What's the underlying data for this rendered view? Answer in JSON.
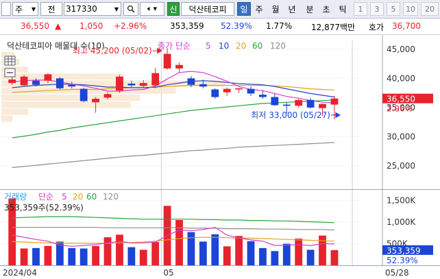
{
  "toolbar": {
    "type_label": "주",
    "prev_label": "전",
    "code": "317330",
    "new_label": "신",
    "stock_name": "덕산테코피",
    "periods": [
      "일",
      "주",
      "월",
      "년",
      "분",
      "초",
      "틱"
    ],
    "active_period": "일",
    "intervals": [
      "1",
      "3",
      "5",
      "10",
      "20"
    ]
  },
  "stock": {
    "price": "36,550",
    "change": "1,050",
    "change_pct": "+2.96%",
    "volume": "353,359",
    "vol_ratio": "52.39%",
    "turnover": "1.77%",
    "amount": "12,877백만",
    "bid_label": "호가",
    "bid_price": "36,700"
  },
  "colors": {
    "up": "#e8232d",
    "down": "#1b45d6",
    "ma5": "#d63bd1",
    "ma10": "#2142c4",
    "ma20": "#e5a11b",
    "ma60": "#29a33a",
    "ma120": "#8c8c8c"
  },
  "chart_data": {
    "type": "candlestick",
    "price_legend": {
      "title": "덕산테코피아 매물대 수(10)",
      "ma_label": "종가 단순",
      "periods": [
        "5",
        "10",
        "20",
        "60",
        "120"
      ]
    },
    "volume_legend": {
      "title": "거래량",
      "ma_label": "단순",
      "periods": [
        "5",
        "20",
        "60",
        "120"
      ]
    },
    "y_ticks": [
      "45,000",
      "40,000",
      "35,000",
      "30,000",
      "25,000"
    ],
    "y_tick_values": [
      45000,
      40000,
      35000,
      30000,
      25000
    ],
    "ylim": [
      21000,
      46500
    ],
    "vol_ticks": [
      "1,500K",
      "1,000K",
      "500K"
    ],
    "vol_tick_values": [
      1500000,
      1000000,
      500000
    ],
    "vol_ylim": [
      0,
      1750000
    ],
    "x_labels": [
      {
        "text": "2024/04",
        "index": 0
      },
      {
        "text": "05",
        "index": 13
      },
      {
        "text": "05/28",
        "index": 29
      }
    ],
    "high_annotation": "최고 45,200 (05/02)",
    "low_annotation": "최저 33,000 (05/27)",
    "high_index": 13,
    "high_value": 45200,
    "low_index": 28,
    "low_value": 33000,
    "volume_annotation": "353,359주(52.39%)",
    "current_price_tag": "36,550",
    "current_pct_tag": "2.96%",
    "current_volume_tag": "353,359",
    "current_vol_pct_tag": "52.39%",
    "current_price_value": 36550,
    "current_volume_value": 353359,
    "candles": [
      {
        "o": 39200,
        "h": 40400,
        "l": 38900,
        "c": 39800
      },
      {
        "o": 38800,
        "h": 40600,
        "l": 38600,
        "c": 40300
      },
      {
        "o": 39600,
        "h": 40000,
        "l": 38600,
        "c": 38900
      },
      {
        "o": 39600,
        "h": 40900,
        "l": 39200,
        "c": 40700
      },
      {
        "o": 40000,
        "h": 40200,
        "l": 38100,
        "c": 38300
      },
      {
        "o": 38900,
        "h": 39400,
        "l": 38300,
        "c": 38600
      },
      {
        "o": 38200,
        "h": 38400,
        "l": 35900,
        "c": 36100
      },
      {
        "o": 35900,
        "h": 36800,
        "l": 34100,
        "c": 36500
      },
      {
        "o": 36700,
        "h": 37600,
        "l": 36400,
        "c": 37300
      },
      {
        "o": 37900,
        "h": 40600,
        "l": 37500,
        "c": 40300
      },
      {
        "o": 39100,
        "h": 39600,
        "l": 38500,
        "c": 38800
      },
      {
        "o": 38700,
        "h": 39700,
        "l": 38400,
        "c": 39200
      },
      {
        "o": 38800,
        "h": 41800,
        "l": 38300,
        "c": 40900
      },
      {
        "o": 41700,
        "h": 45200,
        "l": 41500,
        "c": 44200
      },
      {
        "o": 41700,
        "h": 42700,
        "l": 41000,
        "c": 42300
      },
      {
        "o": 40000,
        "h": 40400,
        "l": 38500,
        "c": 38900
      },
      {
        "o": 39000,
        "h": 39800,
        "l": 38300,
        "c": 38600
      },
      {
        "o": 38100,
        "h": 38300,
        "l": 36500,
        "c": 36800
      },
      {
        "o": 37600,
        "h": 38400,
        "l": 37000,
        "c": 38200
      },
      {
        "o": 38100,
        "h": 38300,
        "l": 37500,
        "c": 38300
      },
      {
        "o": 38200,
        "h": 38600,
        "l": 37000,
        "c": 37400
      },
      {
        "o": 37200,
        "h": 37900,
        "l": 36500,
        "c": 36800
      },
      {
        "o": 36800,
        "h": 37400,
        "l": 35300,
        "c": 35400
      },
      {
        "o": 35500,
        "h": 35900,
        "l": 34000,
        "c": 35300
      },
      {
        "o": 35300,
        "h": 36500,
        "l": 35000,
        "c": 36300
      },
      {
        "o": 36300,
        "h": 36600,
        "l": 34800,
        "c": 35000
      },
      {
        "o": 34900,
        "h": 35700,
        "l": 33600,
        "c": 35600
      },
      {
        "o": 35500,
        "h": 37000,
        "l": 33000,
        "c": 36550
      }
    ],
    "volumes": [
      1550000,
      390000,
      400000,
      450000,
      550000,
      400000,
      390000,
      450000,
      650000,
      710000,
      420000,
      360000,
      540000,
      1380000,
      1050000,
      770000,
      550000,
      720000,
      440000,
      680000,
      560000,
      400000,
      330000,
      500000,
      620000,
      360000,
      690000,
      353359
    ],
    "ma": {
      "ma5": [
        39400,
        39600,
        39700,
        39700,
        39400,
        39000,
        38700,
        38300,
        37800,
        37800,
        38000,
        38100,
        38700,
        39900,
        41000,
        41200,
        41000,
        40300,
        39500,
        38600,
        38100,
        37900,
        37400,
        36900,
        36600,
        36200,
        35900,
        35800
      ],
      "ma10": [
        38400,
        38600,
        38800,
        38900,
        39000,
        39000,
        38900,
        38700,
        38500,
        38500,
        38400,
        38400,
        38500,
        38900,
        39200,
        39500,
        39600,
        39500,
        39300,
        39100,
        39000,
        38900,
        38600,
        38200,
        37800,
        37400,
        37100,
        36800
      ],
      "ma20": [
        37600,
        37700,
        37800,
        37900,
        38000,
        38100,
        38100,
        38100,
        38200,
        38300,
        38400,
        38400,
        38500,
        38600,
        38700,
        38800,
        38800,
        38800,
        38800,
        38800,
        38800,
        38800,
        38700,
        38600,
        38400,
        38200,
        38100,
        38000
      ],
      "ma60": [
        29800,
        30100,
        30400,
        30800,
        31100,
        31500,
        31800,
        32100,
        32400,
        32700,
        33000,
        33300,
        33600,
        33900,
        34200,
        34500,
        34700,
        34900,
        35100,
        35300,
        35500,
        35700,
        35800,
        35900,
        36000,
        36100,
        36200,
        36300
      ],
      "ma120": [
        24700,
        24900,
        25100,
        25300,
        25500,
        25700,
        25900,
        26100,
        26300,
        26500,
        26700,
        26800,
        27000,
        27200,
        27400,
        27600,
        27700,
        27900,
        28000,
        28200,
        28300,
        28400,
        28500,
        28600,
        28700,
        28800,
        28900,
        29000
      ],
      "vma5": [
        700000,
        650000,
        600000,
        560000,
        470000,
        440000,
        460000,
        480000,
        520000,
        560000,
        520000,
        520000,
        540000,
        690000,
        820000,
        800000,
        830000,
        880000,
        700000,
        630000,
        590000,
        560000,
        460000,
        470000,
        480000,
        460000,
        500000,
        500000
      ],
      "vma20": [
        550000,
        540000,
        530000,
        520000,
        520000,
        510000,
        510000,
        510000,
        510000,
        520000,
        530000,
        540000,
        560000,
        590000,
        620000,
        640000,
        650000,
        650000,
        640000,
        630000,
        630000,
        620000,
        610000,
        600000,
        590000,
        580000,
        570000,
        560000
      ],
      "vma60": [
        1100000,
        1110000,
        1120000,
        1130000,
        1130000,
        1130000,
        1120000,
        1110000,
        1100000,
        1090000,
        1080000,
        1070000,
        1070000,
        1070000,
        1070000,
        1070000,
        1060000,
        1060000,
        1050000,
        1050000,
        1040000,
        1040000,
        1030000,
        1030000,
        1020000,
        1010000,
        1000000,
        990000
      ],
      "vma120": [
        880000,
        880000,
        880000,
        880000,
        880000,
        880000,
        880000,
        880000,
        870000,
        870000,
        870000,
        870000,
        870000,
        870000,
        870000,
        860000,
        860000,
        860000,
        850000,
        850000,
        850000,
        840000,
        840000,
        840000,
        830000,
        830000,
        830000,
        820000
      ]
    },
    "volume_profile": [
      {
        "price": 44000,
        "weight": 0.06
      },
      {
        "price": 42800,
        "weight": 0.08
      },
      {
        "price": 41500,
        "weight": 0.12
      },
      {
        "price": 40300,
        "weight": 0.55
      },
      {
        "price": 39100,
        "weight": 1.0
      },
      {
        "price": 37900,
        "weight": 0.78
      },
      {
        "price": 36700,
        "weight": 0.62
      },
      {
        "price": 35500,
        "weight": 0.58
      },
      {
        "price": 34300,
        "weight": 0.12
      },
      {
        "price": 33100,
        "weight": 0.05
      }
    ]
  }
}
